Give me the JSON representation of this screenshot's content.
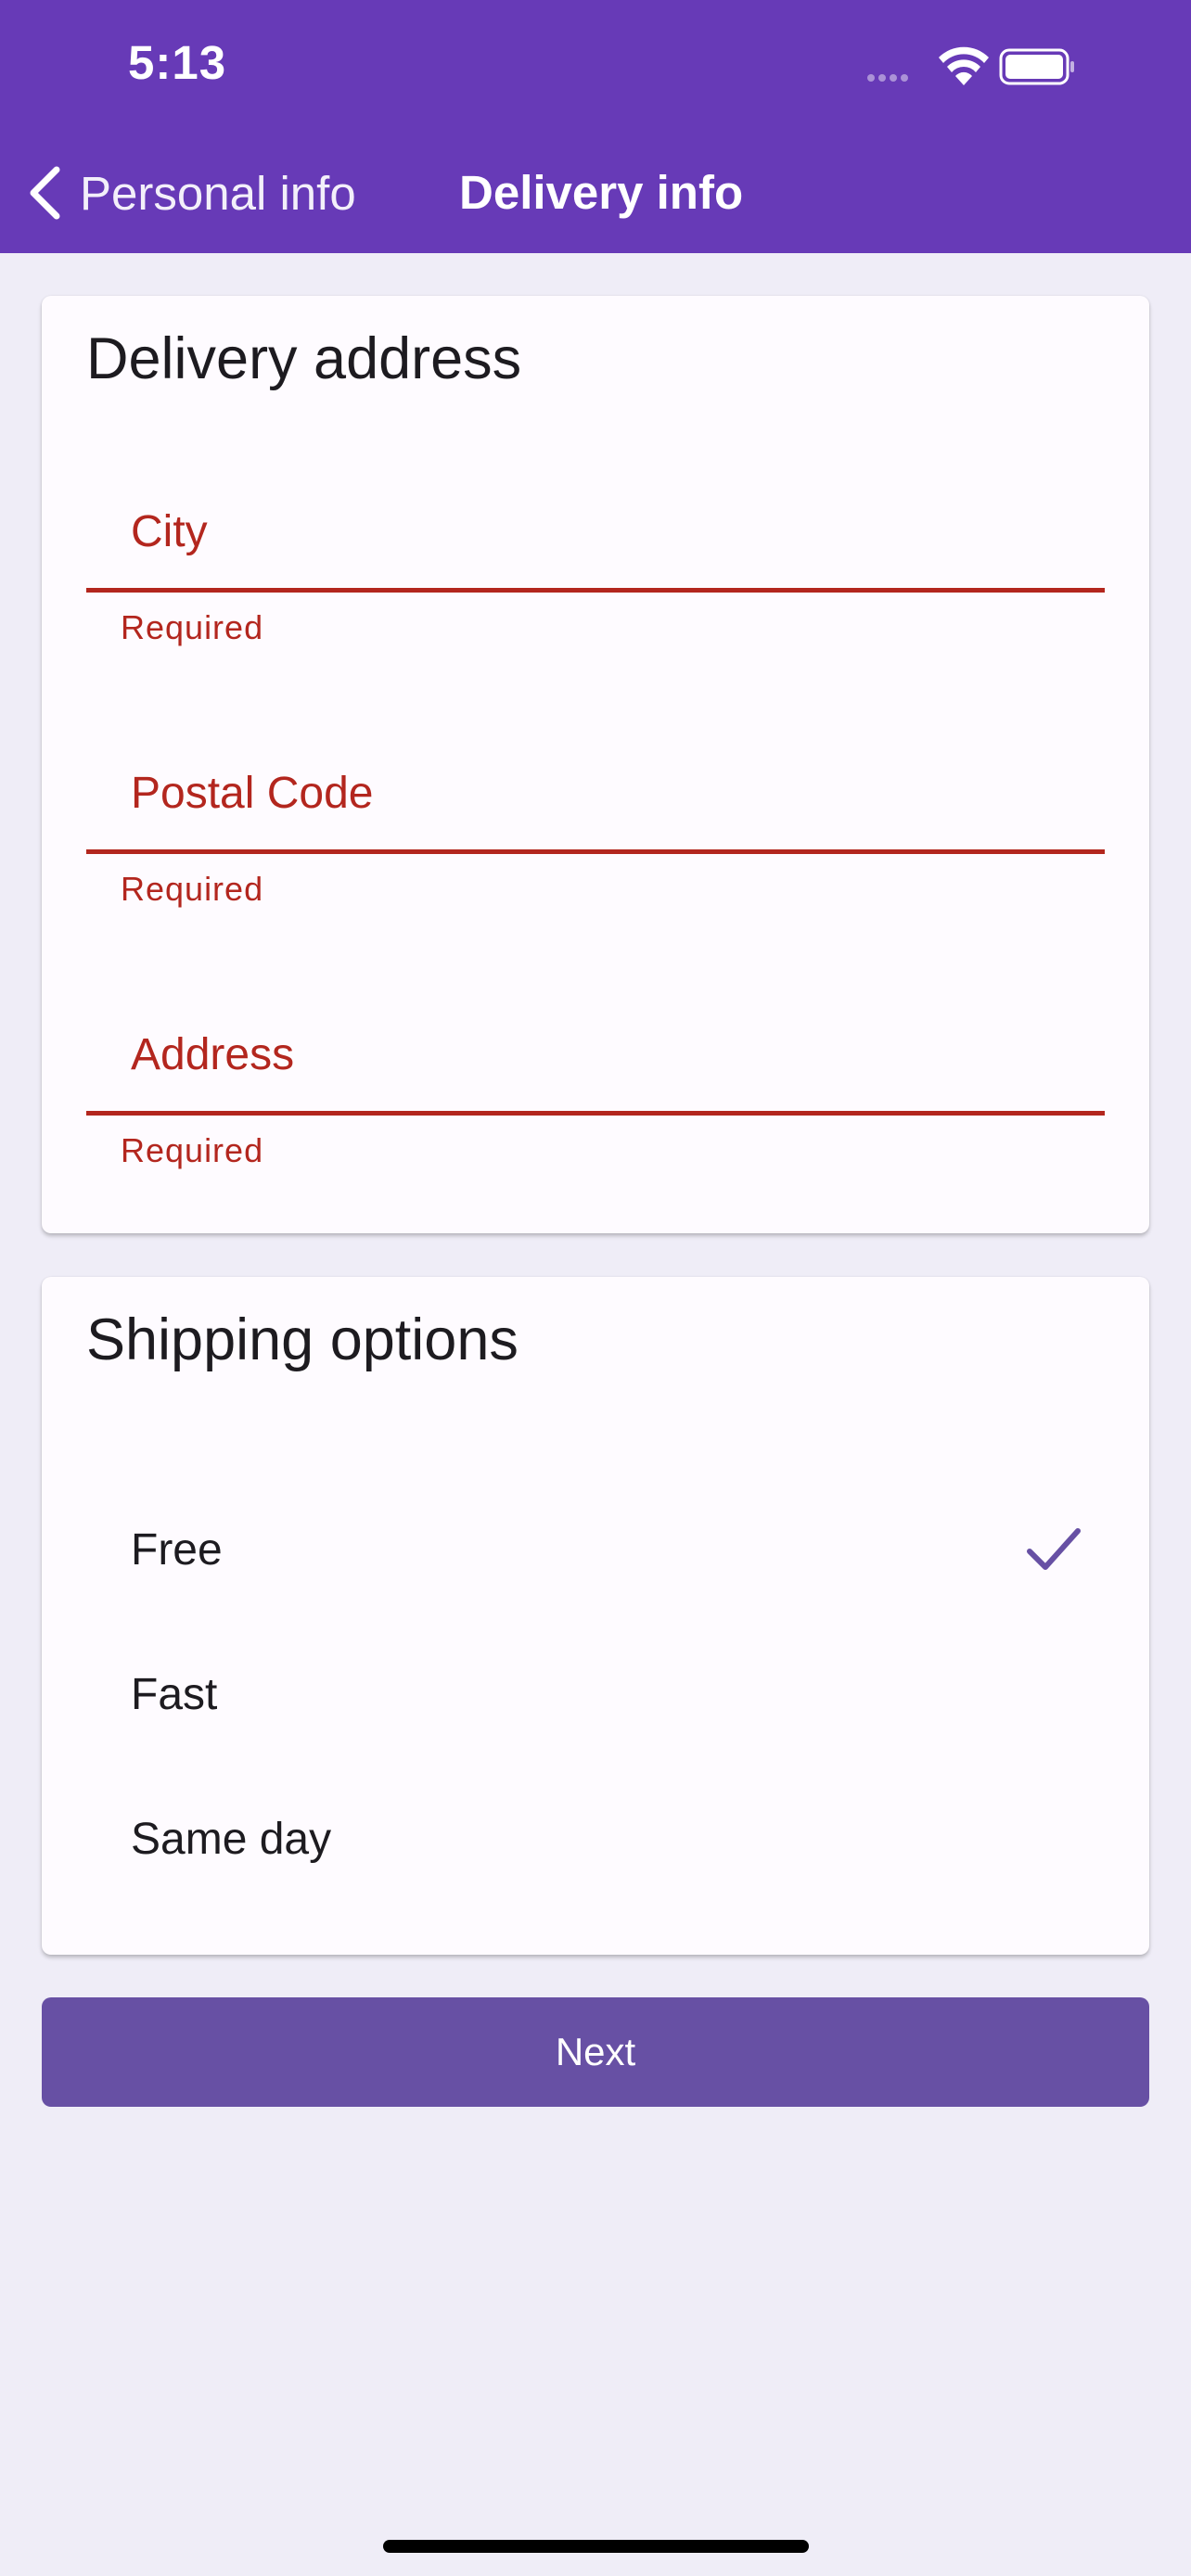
{
  "status_bar": {
    "time": "5:13",
    "icons": [
      "signal-icon",
      "wifi-icon",
      "battery-icon"
    ]
  },
  "nav": {
    "back_label": "Personal info",
    "title": "Delivery info"
  },
  "delivery_card": {
    "title": "Delivery address",
    "fields": [
      {
        "placeholder": "City",
        "value": "",
        "error": "Required"
      },
      {
        "placeholder": "Postal Code",
        "value": "",
        "error": "Required"
      },
      {
        "placeholder": "Address",
        "value": "",
        "error": "Required"
      }
    ]
  },
  "shipping_card": {
    "title": "Shipping options",
    "options": [
      {
        "label": "Free",
        "selected": true
      },
      {
        "label": "Fast",
        "selected": false
      },
      {
        "label": "Same day",
        "selected": false
      }
    ]
  },
  "actions": {
    "next_label": "Next"
  },
  "colors": {
    "header": "#673ab7",
    "background": "#efedf7",
    "error": "#b3261e",
    "primary": "#6750a4"
  }
}
